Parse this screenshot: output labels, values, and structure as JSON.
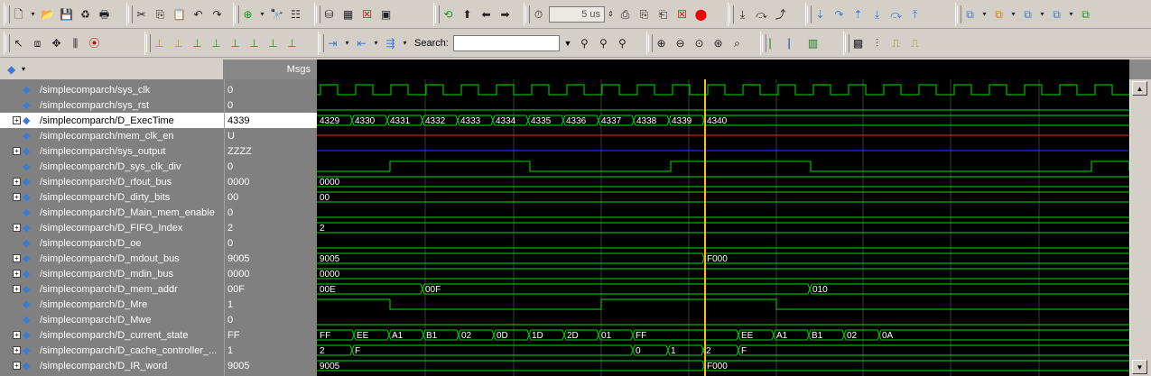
{
  "toolbar": {
    "time_value": "5 us",
    "search_label": "Search:",
    "search_value": ""
  },
  "header": {
    "msgs_label": "Msgs"
  },
  "signals": [
    {
      "name": "/simplecomparch/sys_clk",
      "value": "0",
      "expandable": false
    },
    {
      "name": "/simplecomparch/sys_rst",
      "value": "0",
      "expandable": false
    },
    {
      "name": "/simplecomparch/D_ExecTime",
      "value": "4339",
      "expandable": true,
      "selected": true
    },
    {
      "name": "/simplecomparch/mem_clk_en",
      "value": "U",
      "expandable": false
    },
    {
      "name": "/simplecomparch/sys_output",
      "value": "ZZZZ",
      "expandable": true
    },
    {
      "name": "/simplecomparch/D_sys_clk_div",
      "value": "0",
      "expandable": false
    },
    {
      "name": "/simplecomparch/D_rfout_bus",
      "value": "0000",
      "expandable": true
    },
    {
      "name": "/simplecomparch/D_dirty_bits",
      "value": "00",
      "expandable": true
    },
    {
      "name": "/simplecomparch/D_Main_mem_enable",
      "value": "0",
      "expandable": false
    },
    {
      "name": "/simplecomparch/D_FIFO_Index",
      "value": "2",
      "expandable": true
    },
    {
      "name": "/simplecomparch/D_oe",
      "value": "0",
      "expandable": false
    },
    {
      "name": "/simplecomparch/D_mdout_bus",
      "value": "9005",
      "expandable": true
    },
    {
      "name": "/simplecomparch/D_mdin_bus",
      "value": "0000",
      "expandable": true
    },
    {
      "name": "/simplecomparch/D_mem_addr",
      "value": "00F",
      "expandable": true
    },
    {
      "name": "/simplecomparch/D_Mre",
      "value": "1",
      "expandable": false
    },
    {
      "name": "/simplecomparch/D_Mwe",
      "value": "0",
      "expandable": false
    },
    {
      "name": "/simplecomparch/D_current_state",
      "value": "FF",
      "expandable": true
    },
    {
      "name": "/simplecomparch/D_cache_controller_...",
      "value": "1",
      "expandable": true
    },
    {
      "name": "/simplecomparch/D_IR_word",
      "value": "9005",
      "expandable": true
    }
  ],
  "waves": {
    "exec_time_labels": [
      "4329",
      "4330",
      "4331",
      "4332",
      "4333",
      "4334",
      "4335",
      "4336",
      "4337",
      "4338",
      "4339",
      "4340"
    ],
    "rfout_label": "0000",
    "dirty_label": "00",
    "fifo_label": "2",
    "mdout_labels": [
      "9005",
      "F000"
    ],
    "mdin_label": "0000",
    "mem_addr_labels": [
      "00E",
      "00F",
      "010"
    ],
    "state_labels": [
      "FF",
      "EE",
      "A1",
      "B1",
      "02",
      "0D",
      "1D",
      "2D",
      "01",
      "FF",
      "EE",
      "A1",
      "B1",
      "02",
      "0A"
    ],
    "cache_ctrl_labels": [
      "2",
      "F",
      "0",
      "1",
      "2",
      "F"
    ],
    "ir_labels": [
      "9005",
      "F000"
    ]
  },
  "colors": {
    "wave": "#00e000",
    "red": "#ff2020",
    "blue": "#2040ff",
    "cursor": "#ffc000",
    "grid": "#3a3a3a"
  }
}
